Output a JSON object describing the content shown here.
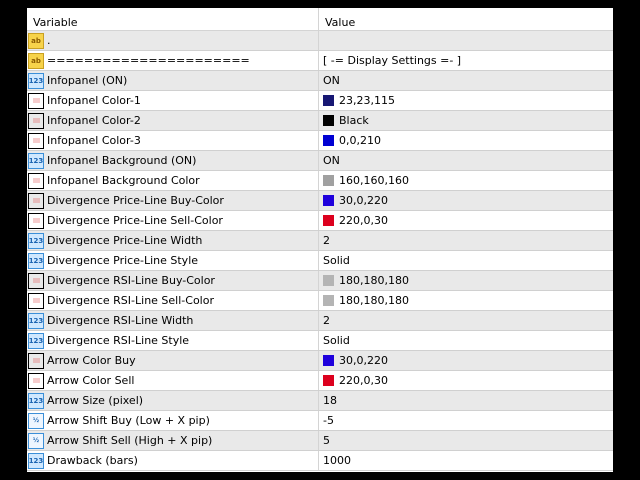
{
  "header": {
    "variable": "Variable",
    "value": "Value"
  },
  "rows": [
    {
      "type": "ab",
      "name": ".",
      "value": ""
    },
    {
      "type": "ab",
      "name": "======================",
      "value": "[ -= Display Settings =- ]"
    },
    {
      "type": "int",
      "name": "Infopanel (ON)",
      "value": "ON"
    },
    {
      "type": "color",
      "name": "Infopanel Color-1",
      "value": "23,23,115",
      "color": "#171773"
    },
    {
      "type": "color",
      "name": "Infopanel Color-2",
      "value": "Black",
      "color": "#000000"
    },
    {
      "type": "color",
      "name": "Infopanel Color-3",
      "value": "0,0,210",
      "color": "#0000d2"
    },
    {
      "type": "int",
      "name": "Infopanel Background (ON)",
      "value": "ON"
    },
    {
      "type": "color",
      "name": "Infopanel Background Color",
      "value": "160,160,160",
      "color": "#a0a0a0"
    },
    {
      "type": "color",
      "name": "Divergence Price-Line Buy-Color",
      "value": "30,0,220",
      "color": "#1e00dc"
    },
    {
      "type": "color",
      "name": "Divergence Price-Line Sell-Color",
      "value": "220,0,30",
      "color": "#dc001e"
    },
    {
      "type": "int",
      "name": "Divergence Price-Line Width",
      "value": "2"
    },
    {
      "type": "int",
      "name": "Divergence Price-Line Style",
      "value": "Solid"
    },
    {
      "type": "color",
      "name": "Divergence RSI-Line Buy-Color",
      "value": "180,180,180",
      "color": "#b4b4b4"
    },
    {
      "type": "color",
      "name": "Divergence RSI-Line Sell-Color",
      "value": "180,180,180",
      "color": "#b4b4b4"
    },
    {
      "type": "int",
      "name": "Divergence RSI-Line Width",
      "value": "2"
    },
    {
      "type": "int",
      "name": "Divergence RSI-Line Style",
      "value": "Solid"
    },
    {
      "type": "color",
      "name": "Arrow Color Buy",
      "value": "30,0,220",
      "color": "#1e00dc"
    },
    {
      "type": "color",
      "name": "Arrow Color Sell",
      "value": "220,0,30",
      "color": "#dc001e"
    },
    {
      "type": "int",
      "name": "Arrow Size (pixel)",
      "value": "18"
    },
    {
      "type": "dbl",
      "name": "Arrow Shift Buy (Low + X pip)",
      "value": "-5"
    },
    {
      "type": "dbl",
      "name": "Arrow Shift Sell (High + X pip)",
      "value": "5"
    },
    {
      "type": "int",
      "name": "Drawback (bars)",
      "value": "1000"
    }
  ],
  "icon_text": {
    "ab": "ab",
    "int": "123",
    "dbl": "½"
  }
}
